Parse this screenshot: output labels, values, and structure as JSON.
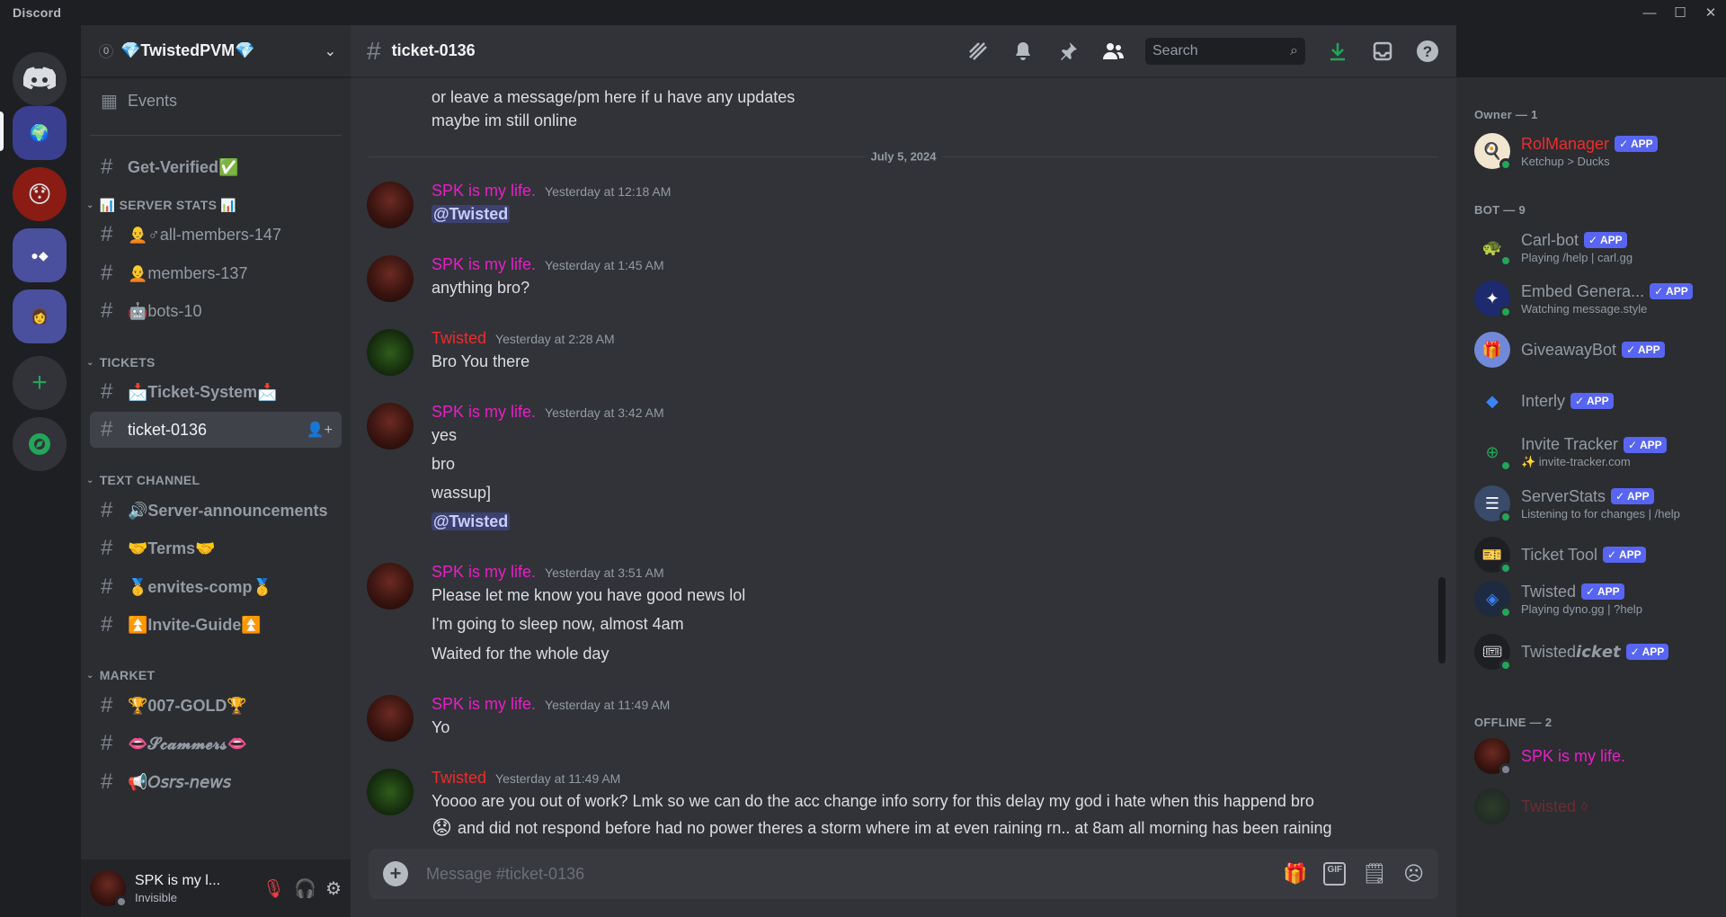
{
  "window": {
    "app_title": "Discord",
    "controls": [
      "—",
      "☐",
      "✕"
    ]
  },
  "server_rail": {
    "servers": [
      "Direct Messages",
      "Server 1",
      "Server 2",
      "Server 3",
      "Server 4"
    ],
    "add_label": "+",
    "explore_label": "Explore"
  },
  "guild": {
    "unread_count": "0",
    "name": "💎TwistedPVM💎"
  },
  "channels": {
    "events": "Events",
    "get_verified": "Get-Verified✅",
    "cat_server_stats": "📊 SERVER STATS 📊",
    "all_members": "🧑‍🦲♂all-members-147",
    "members": "🧑‍🦲members-137",
    "bots": "🤖bots-10",
    "cat_tickets": "TICKETS",
    "ticket_system": "📩Ticket-System📩",
    "ticket_0136": "ticket-0136",
    "cat_text": "TEXT CHANNEL",
    "server_ann": "🔊Server-announcements",
    "terms": "🤝Terms🤝",
    "envites": "🥇envites-comp🥇",
    "invite_guide": "⏫Invite-Guide⏫",
    "cat_market": "MARKET",
    "gold": "🏆007-GOLD🏆",
    "scammers": "👄𝓢𝓬𝓪𝓶𝓶𝓮𝓻𝓼👄",
    "osrs_news": "📢𝘖𝘴𝘳𝘴-𝘯𝘦𝘸𝘴"
  },
  "user_panel": {
    "name": "SPK is my l...",
    "status": "Invisible"
  },
  "topbar": {
    "channel": "ticket-0136",
    "search_placeholder": "Search"
  },
  "messages": {
    "prev_line1": "or leave a message/pm here if u have any updates",
    "prev_line2": "maybe im still online",
    "date_divider": "July 5, 2024",
    "groups": [
      {
        "author": "SPK is my life.",
        "time": "Yesterday at 12:18 AM",
        "lines": [
          "@Twisted"
        ]
      },
      {
        "author": "SPK is my life.",
        "time": "Yesterday at 1:45 AM",
        "lines": [
          "anything bro?"
        ]
      },
      {
        "author": "Twisted",
        "time": "Yesterday at 2:28 AM",
        "lines": [
          "Bro You there"
        ]
      },
      {
        "author": "SPK is my life.",
        "time": "Yesterday at 3:42 AM",
        "lines": [
          "yes",
          "bro",
          "wassup]",
          "@Twisted"
        ]
      },
      {
        "author": "SPK is my life.",
        "time": "Yesterday at 3:51 AM",
        "lines": [
          "Please let me know you have good news lol",
          "I'm going to sleep now, almost 4am",
          "Waited for the whole day"
        ]
      },
      {
        "author": "SPK is my life.",
        "time": "Yesterday at 11:49 AM",
        "lines": [
          "Yo"
        ]
      },
      {
        "author": "Twisted",
        "time": "Yesterday at 11:49 AM",
        "lines": [
          "Yoooo are you out of work? Lmk so we can do the acc change info sorry for this delay my god i hate when this happend bro",
          "and did not respond before had no power theres a storm where im at even raining rn.. at 8am all morning has been raining"
        ]
      }
    ]
  },
  "composer": {
    "placeholder": "Message #ticket-0136"
  },
  "member_list": {
    "owner_header": "Owner — 1",
    "bot_header": "BOT — 9",
    "offline_header": "OFFLINE — 2",
    "app_tag": "✓ APP",
    "owner": {
      "name": "RolManager",
      "sub": "Ketchup > Ducks"
    },
    "bots": [
      {
        "name": "Carl-bot",
        "sub": "Playing /help | carl.gg"
      },
      {
        "name": "Embed Genera...",
        "sub": "Watching message.style"
      },
      {
        "name": "GiveawayBot",
        "sub": ""
      },
      {
        "name": "Interly",
        "sub": ""
      },
      {
        "name": "Invite Tracker",
        "sub": "✨ invite-tracker.com"
      },
      {
        "name": "ServerStats",
        "sub": "Listening to for changes | /help"
      },
      {
        "name": "Ticket Tool",
        "sub": ""
      },
      {
        "name": "Twisted",
        "sub": "Playing dyno.gg | ?help"
      },
      {
        "name": "Twisted𝙞𝙘𝙠𝙚𝙩",
        "sub": ""
      }
    ],
    "offline": [
      {
        "name": "SPK is my life."
      },
      {
        "name": "Twisted"
      }
    ]
  },
  "colors": {
    "spk": "#e91ec8",
    "twisted": "#ed2c2c",
    "accent": "#5865f2",
    "online": "#23a55a"
  }
}
